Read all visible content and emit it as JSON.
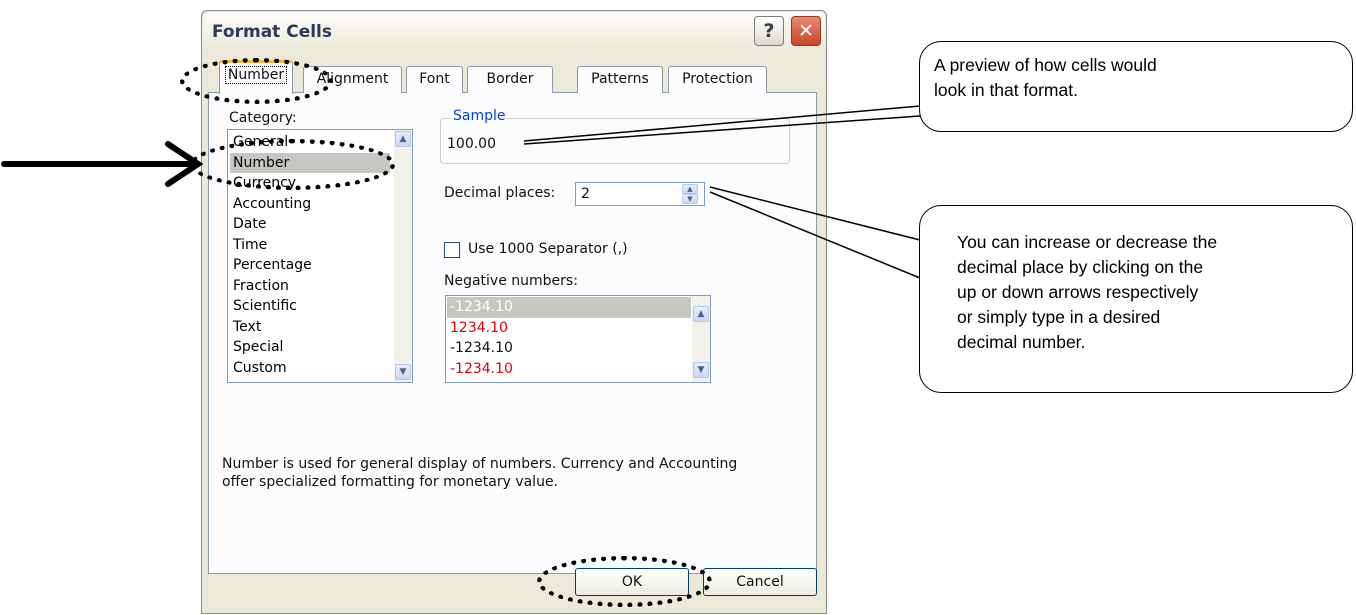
{
  "dialog": {
    "title": "Format Cells",
    "help_glyph": "?",
    "close_glyph": "✕"
  },
  "tabs": [
    {
      "label": "Number",
      "active": true
    },
    {
      "label": "Alignment",
      "active": false
    },
    {
      "label": "Font",
      "active": false
    },
    {
      "label": "Border",
      "active": false
    },
    {
      "label": "Patterns",
      "active": false
    },
    {
      "label": "Protection",
      "active": false
    }
  ],
  "category": {
    "label": "Category:",
    "items": [
      "General",
      "Number",
      "Currency",
      "Accounting",
      "Date",
      "Time",
      "Percentage",
      "Fraction",
      "Scientific",
      "Text",
      "Special",
      "Custom"
    ],
    "selected": "Number"
  },
  "sample": {
    "legend": "Sample",
    "value": "100.00"
  },
  "decimal_places": {
    "label": "Decimal places:",
    "value": "2"
  },
  "separator": {
    "label": "Use 1000 Separator (,)",
    "checked": false
  },
  "negative_numbers": {
    "label": "Negative numbers:",
    "items": [
      {
        "text": "-1234.10",
        "color": "#111111",
        "selected": true
      },
      {
        "text": "1234.10",
        "color": "#e00000",
        "selected": false
      },
      {
        "text": "-1234.10",
        "color": "#111111",
        "selected": false
      },
      {
        "text": "-1234.10",
        "color": "#e00000",
        "selected": false
      }
    ]
  },
  "description": {
    "line1": "Number is used for general display of numbers.  Currency and Accounting",
    "line2": "offer specialized formatting for monetary value."
  },
  "buttons": {
    "ok": "OK",
    "cancel": "Cancel"
  },
  "callouts": {
    "preview": {
      "line1": "A preview of how cells would",
      "line2": "look in that format."
    },
    "decimal": {
      "line1": "You can increase or decrease the",
      "line2": "decimal place by clicking on the",
      "line3": "up or down arrows respectively",
      "line4": "or simply type in a desired",
      "line5": "decimal number."
    }
  },
  "colors": {
    "dialog_bg": "#ece9d8",
    "panel_bg": "#fcfcfe",
    "accent_legend": "#0046d5",
    "negative_red": "#e00000",
    "close_button": "#c8462c"
  }
}
